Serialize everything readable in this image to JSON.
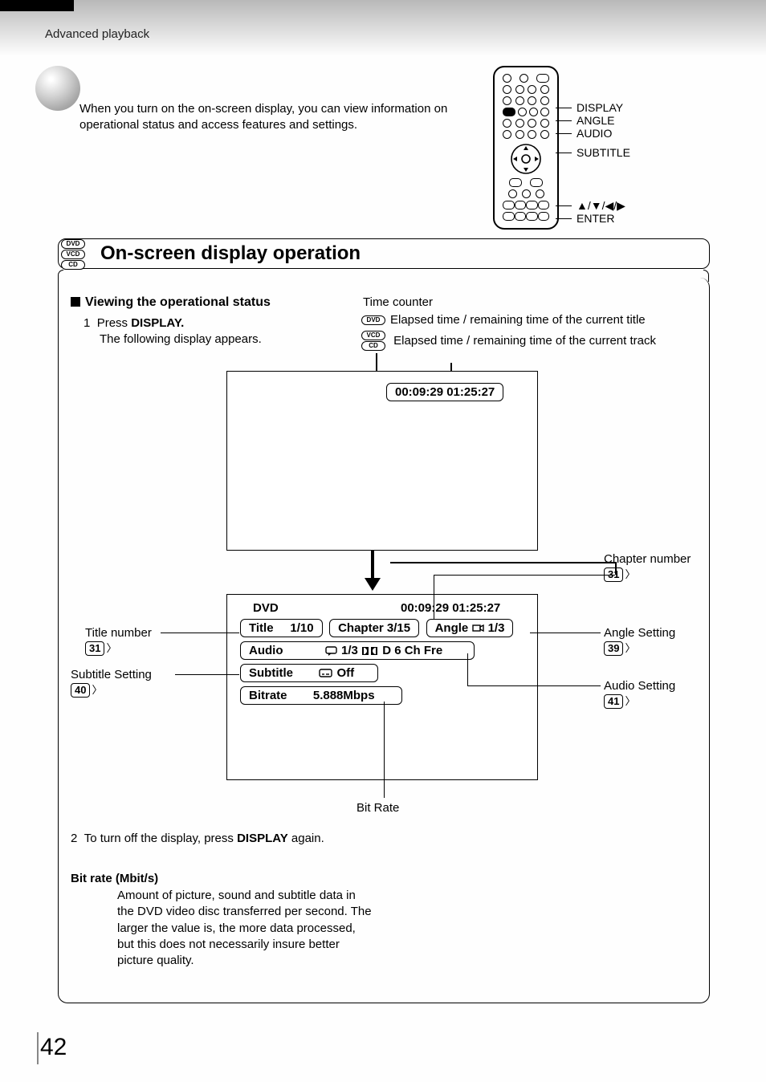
{
  "header": "Advanced playback",
  "intro": "When you turn on the on-screen display, you can view information on operational status and access features and settings.",
  "remote_labels": {
    "display": "DISPLAY",
    "angle": "ANGLE",
    "audio": "AUDIO",
    "subtitle": "SUBTITLE",
    "arrows": "▲/▼/◀/▶",
    "enter": "ENTER"
  },
  "disc_badges": {
    "dvd": "DVD",
    "vcd": "VCD",
    "cd": "CD"
  },
  "section_title": "On-screen display operation",
  "viewing": {
    "heading": "Viewing the operational status",
    "step1_num": "1",
    "step1_prefix": "Press ",
    "step1_display": "DISPLAY.",
    "step1_tail": "The following display appears.",
    "time_counter_label": "Time counter",
    "line_dvd": "Elapsed time / remaining time of the current title",
    "line_vcd": "Elapsed time / remaining time of the current track"
  },
  "osd1": {
    "time": "00:09:29  01:25:27"
  },
  "osd2": {
    "disc": "DVD",
    "time": "00:09:29  01:25:27",
    "title_label": "Title",
    "title_val": "1/10",
    "chapter": "Chapter 3/15",
    "angle_label": "Angle",
    "angle_val": "1/3",
    "audio_label": "Audio",
    "audio_val": "1/3",
    "audio_surround": "D 6 Ch Fre",
    "subtitle_label": "Subtitle",
    "subtitle_val": "Off",
    "bitrate_label": "Bitrate",
    "bitrate_val": "5.888Mbps"
  },
  "callouts": {
    "title_number": {
      "label": "Title number",
      "page": "31"
    },
    "subtitle_setting": {
      "label": "Subtitle Setting",
      "page": "40"
    },
    "chapter_number": {
      "label": "Chapter number",
      "page": "31"
    },
    "angle_setting": {
      "label": "Angle Setting",
      "page": "39"
    },
    "audio_setting": {
      "label": "Audio Setting",
      "page": "41"
    },
    "bit_rate": "Bit Rate"
  },
  "step2": {
    "num": "2",
    "prefix": "To turn off the display, press ",
    "display": "DISPLAY",
    "suffix": " again."
  },
  "bitrate_note": {
    "heading": "Bit rate (Mbit/s)",
    "body": "Amount of picture, sound and subtitle data in the DVD video disc transferred per second. The larger the value is, the more data processed, but this does not necessarily insure better picture quality."
  },
  "page_number": "42"
}
